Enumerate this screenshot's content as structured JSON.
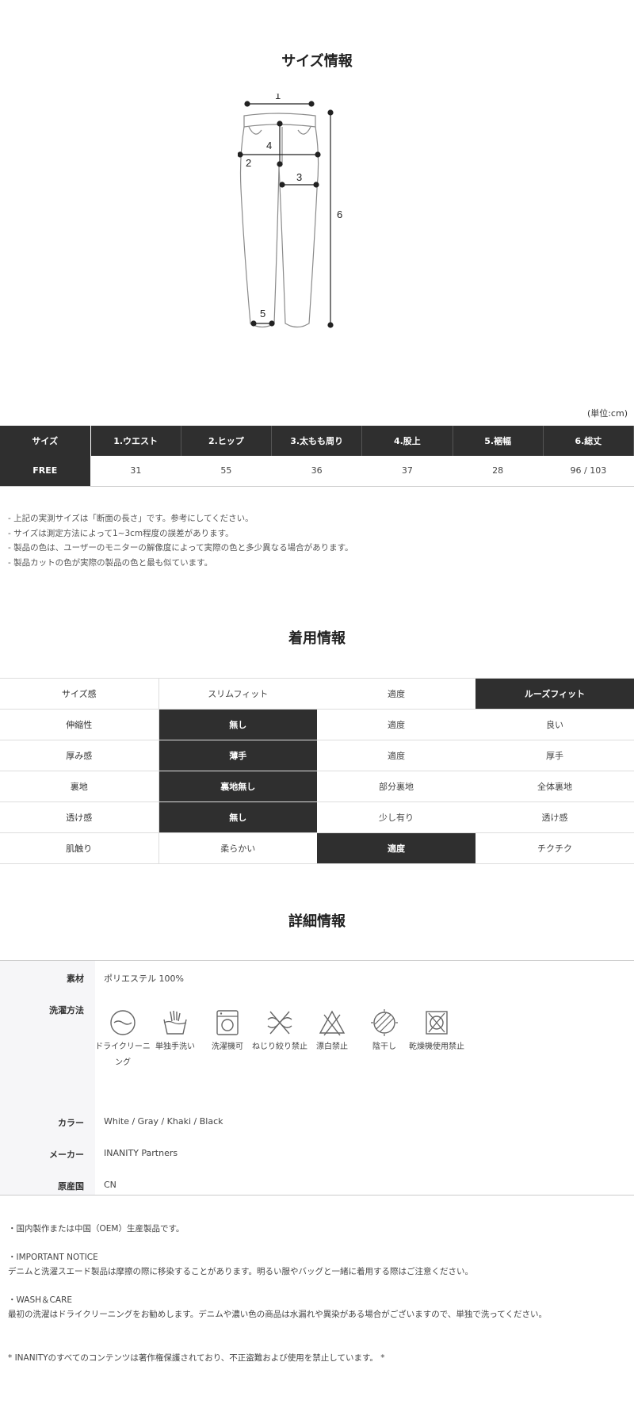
{
  "size_section": {
    "title": "サイズ情報",
    "diagram_labels": [
      "1",
      "2",
      "3",
      "4",
      "5",
      "6"
    ],
    "unit": "(単位:cm)",
    "headers": [
      "サイズ",
      "1.ウエスト",
      "2.ヒップ",
      "3.太もも周り",
      "4.股上",
      "5.裾幅",
      "6.総丈"
    ],
    "rows": [
      [
        "FREE",
        "31",
        "55",
        "36",
        "37",
        "28",
        "96 / 103"
      ]
    ],
    "notes": [
      "- 上記の実測サイズは「断面の長さ」です。参考にしてください。",
      "- サイズは測定方法によって1~3cm程度の誤差があります。",
      "- 製品の色は、ユーザーのモニターの解像度によって実際の色と多少異なる場合があります。",
      "- 製品カットの色が実際の製品の色と最も似ています。"
    ]
  },
  "fit_section": {
    "title": "着用情報",
    "rows": [
      {
        "label": "サイズ感",
        "options": [
          "スリムフィット",
          "適度",
          "ルーズフィット"
        ],
        "selected": 2
      },
      {
        "label": "伸縮性",
        "options": [
          "無し",
          "適度",
          "良い"
        ],
        "selected": 0
      },
      {
        "label": "厚み感",
        "options": [
          "薄手",
          "適度",
          "厚手"
        ],
        "selected": 0
      },
      {
        "label": "裏地",
        "options": [
          "裏地無し",
          "部分裏地",
          "全体裏地"
        ],
        "selected": 0
      },
      {
        "label": "透け感",
        "options": [
          "無し",
          "少し有り",
          "透け感"
        ],
        "selected": 0
      },
      {
        "label": "肌触り",
        "options": [
          "柔らかい",
          "適度",
          "チクチク"
        ],
        "selected": 1
      }
    ]
  },
  "detail_section": {
    "title": "詳細情報",
    "material_label": "素材",
    "material_value": "ポリエステル 100%",
    "care_label": "洗濯方法",
    "care_items": [
      {
        "icon": "dry-clean-icon",
        "label_lines": [
          "ドライクリーニ",
          "ング"
        ]
      },
      {
        "icon": "hand-wash-icon",
        "label_lines": [
          "単独手洗い"
        ]
      },
      {
        "icon": "washing-machine-icon",
        "label_lines": [
          "洗濯機可"
        ]
      },
      {
        "icon": "no-wring-icon",
        "label_lines": [
          "ねじり絞り禁止"
        ]
      },
      {
        "icon": "no-bleach-icon",
        "label_lines": [
          "漂白禁止"
        ]
      },
      {
        "icon": "shade-dry-icon",
        "label_lines": [
          "陰干し"
        ]
      },
      {
        "icon": "no-tumble-dry-icon",
        "label_lines": [
          "乾燥機使用禁止"
        ]
      }
    ],
    "color_label": "カラー",
    "color_value": "White / Gray / Khaki / Black",
    "maker_label": "メーカー",
    "maker_value": "INANITY Partners",
    "origin_label": "原産国",
    "origin_value": "CN"
  },
  "footer": {
    "made_in": "・国内製作または中国（OEM）生産製品です。",
    "notice_title": "・IMPORTANT NOTICE",
    "notice_text": "デニムと洗濯スエード製品は摩擦の際に移染することがあります。明るい服やバッグと一緒に着用する際はご注意ください。",
    "care_title": "・WASH＆CARE",
    "care_text": "最初の洗濯はドライクリーニングをお勧めします。デニムや濃い色の商品は水漏れや異染がある場合がございますので、単独で洗ってください。",
    "copyright": "* INANITYのすべてのコンテンツは著作権保護されており、不正盗難および使用を禁止しています。 *"
  },
  "colors": {
    "dark_cell": "#2f2f2f",
    "border": "#dddddd",
    "sidebar_bg": "#f6f6f8"
  }
}
